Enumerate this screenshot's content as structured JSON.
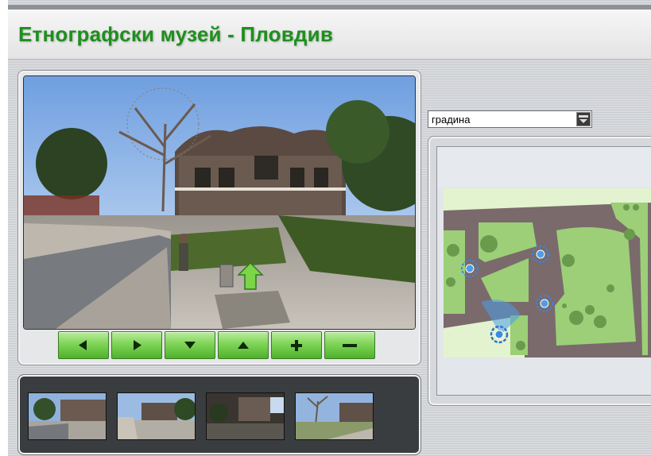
{
  "header": {
    "title": "Етнографски музей - Пловдив"
  },
  "navigation": {
    "buttons": [
      {
        "action": "pan-left",
        "icon": "arrow-left-icon"
      },
      {
        "action": "pan-right",
        "icon": "arrow-right-icon"
      },
      {
        "action": "tilt-down",
        "icon": "arrow-down-icon"
      },
      {
        "action": "tilt-up",
        "icon": "arrow-up-icon"
      },
      {
        "action": "zoom-in",
        "icon": "plus-icon"
      },
      {
        "action": "zoom-out",
        "icon": "minus-icon"
      }
    ]
  },
  "location_select": {
    "selected": "градина"
  },
  "thumbnails": {
    "count": 4
  },
  "map": {
    "hotspots": 4
  },
  "colors": {
    "title": "#1e8f1e",
    "button_green": "#4fb12c",
    "map_path": "#7a6a6b",
    "map_grass": "#9ccf78"
  }
}
